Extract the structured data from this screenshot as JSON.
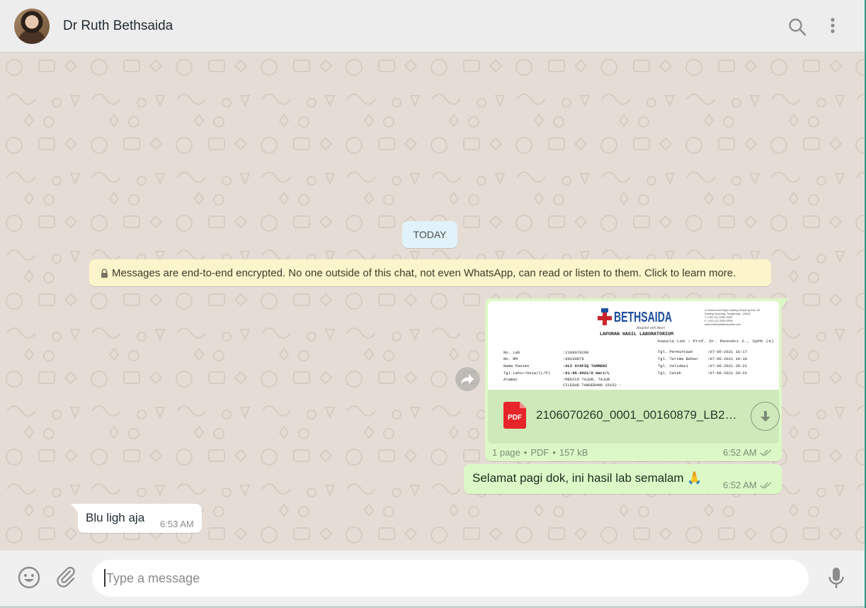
{
  "header": {
    "contact_name": "Dr Ruth Bethsaida",
    "avatar_icon": "contact-avatar",
    "search_icon": "search-icon",
    "menu_icon": "menu-dots-icon"
  },
  "chat": {
    "date_chip": "TODAY",
    "encryption_notice": "Messages are end-to-end encrypted. No one outside of this chat, not even WhatsApp, can read or listen to them. Click to learn more.",
    "messages": [
      {
        "direction": "outgoing",
        "type": "document",
        "preview": {
          "brand": "BETHSAIDA",
          "brand_tagline": "Hospital with Heart",
          "report_title": "LAPORAN HASIL LABORATORIUM",
          "address_lines": [
            "Jl. Boulevard Raya Gading Serpong Kav. 29",
            "Gading Serpong, Tangerang - 15810",
            "T: (+62 21) 2930 0000",
            "F: (+62 21) 2930 0099",
            "www.bethsaidahospitals.com"
          ],
          "supervisor": "Kepala Lab : Prof. Dr. Manoeki S., SpPK (K)",
          "fields_left": [
            {
              "label": "No. Lab",
              "value": ":2106070260"
            },
            {
              "label": "No. RM",
              "value": ":00160879"
            },
            {
              "label": "Nama Pasien",
              "value": ":ALI SYAFIQ TAMRENI"
            },
            {
              "label": "Tgl.Lahir/Usia/(L/P)",
              "value": ":01-06-2021/6 Hari/L"
            },
            {
              "label": "Alamat",
              "value": ":MEDICO TAJUR, TAJUR"
            },
            {
              "label": "",
              "value": " CILEDUG TANGERANG 15152 -"
            }
          ],
          "fields_right": [
            {
              "label": "Tgl. Permintaan",
              "value": ":07-06-2021  16:17"
            },
            {
              "label": "Tgl. Terima Bahan",
              "value": ":07-06-2021  19:18"
            },
            {
              "label": "Tgl. Validasi",
              "value": ":07-06-2021  20:21"
            },
            {
              "label": "Tgl. Cetak",
              "value": ":07-06-2021  20:21"
            }
          ]
        },
        "file_icon_label": "PDF",
        "filename": "2106070260_0001_00160879_LB20...",
        "pages": "1 page",
        "filetype": "PDF",
        "size": "157 kB",
        "time": "6:52 AM",
        "status_icon": "double-check-icon"
      },
      {
        "direction": "outgoing",
        "type": "text",
        "text": "Selamat pagi dok, ini hasil lab semalam 🙏",
        "time": "6:52 AM",
        "status_icon": "double-check-icon"
      },
      {
        "direction": "incoming",
        "type": "text",
        "text": "Blu ligh aja",
        "time": "6:53 AM"
      }
    ]
  },
  "footer": {
    "input_placeholder": "Type a message",
    "emoji_icon": "emoji-icon",
    "attach_icon": "paperclip-icon",
    "mic_icon": "microphone-icon"
  },
  "colors": {
    "header_bg": "#ededed",
    "chat_bg": "#e5ddd5",
    "outgoing_bubble": "#dcf8c6",
    "incoming_bubble": "#ffffff",
    "date_chip_bg": "#e1f2fb",
    "encryption_bg": "#fcf4cb",
    "pdf_red": "#e5252a",
    "brand_blue": "#1d4d9c"
  }
}
